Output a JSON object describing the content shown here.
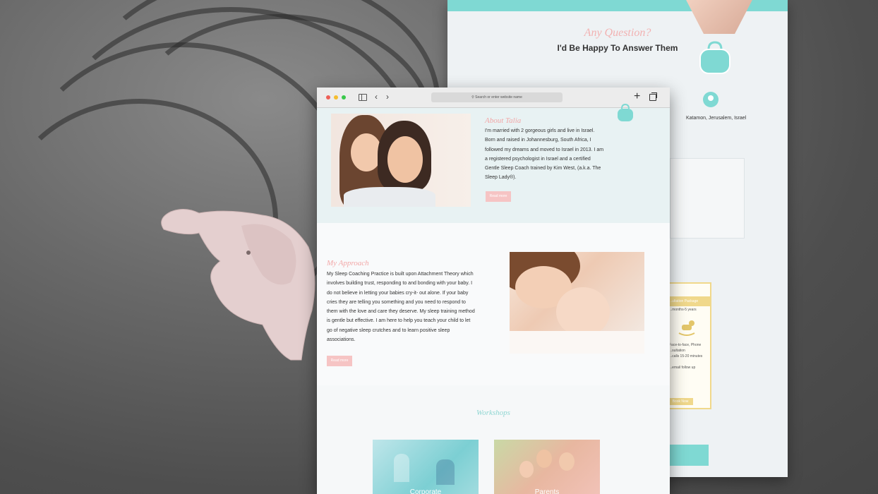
{
  "background": {
    "accent_pink": "#f2a7a7",
    "accent_teal": "#7fd9d3",
    "accent_gold": "#f0d88b"
  },
  "contact_page": {
    "question_title": "Any Question?",
    "question_subtitle": "I'd Be Happy To Answer Them",
    "address": "Katamon, Jerusalem, Israel",
    "package": {
      "heading": "...ultation Package",
      "age": "...months-5 years",
      "items": [
        "Face-to-face, Phone",
        "...sultation",
        "...calls 15-20 minutes",
        "...email follow up"
      ],
      "button": "Book Now"
    }
  },
  "browser": {
    "url_placeholder": "Search or enter website name",
    "nav_back": "‹",
    "nav_forward": "›",
    "new_tab": "+"
  },
  "about": {
    "heading": "About Talia",
    "paragraph_lines": [
      "I'm married with 2 gorgeous girls and live in Israel.",
      "Born and raised in Johannesburg, South Africa, I",
      "followed my dreams and moved to Israel in 2013.  I am",
      "a registered psychologist in Israel and a certified",
      "Gentle Sleep Coach trained by Kim West, (a.k.a. The",
      "Sleep Lady®)."
    ],
    "read_more": "Read more"
  },
  "approach": {
    "heading": "My Approach",
    "paragraph_lines": [
      "My Sleep Coaching Practice is built upon Attachment Theory which",
      "involves building trust, responding to and bonding with your baby. I",
      "do not believe in letting your babies cry-it- out alone. If your baby",
      "cries they are telling you something and you need to respond to",
      "them with the love and care they deserve. My sleep training method",
      "is gentle but effective. I am here to help you teach your child to let",
      "go of negative sleep crutches and to learn positive sleep",
      "associations."
    ],
    "read_more": "Read more"
  },
  "workshops": {
    "title": "Workshops",
    "cards": [
      {
        "label": "Corporate"
      },
      {
        "label": "Parents"
      }
    ]
  }
}
